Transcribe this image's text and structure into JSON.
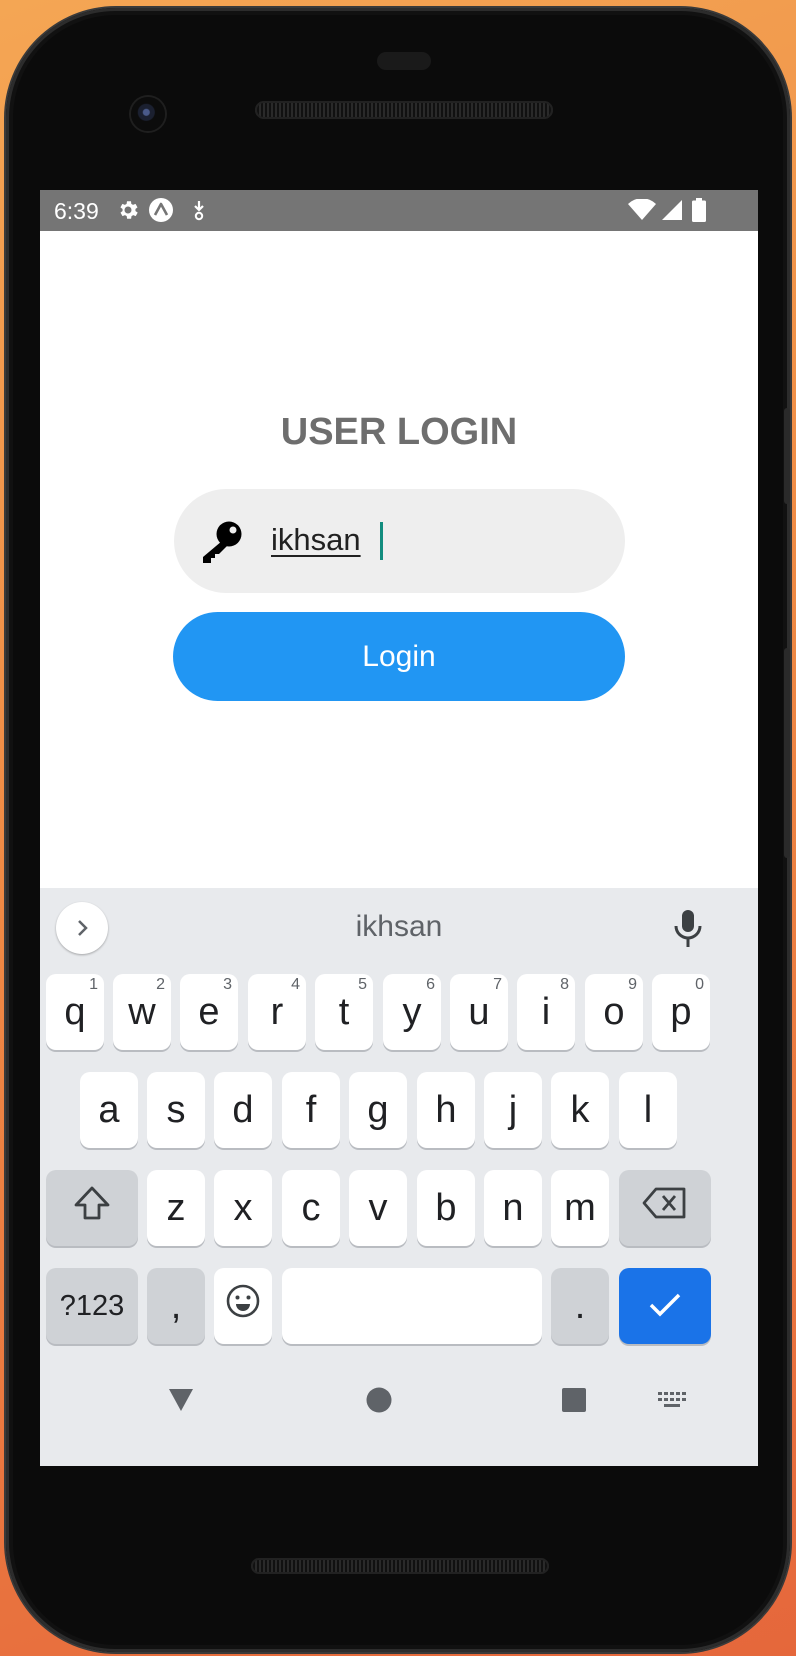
{
  "status_bar": {
    "time": "6:39",
    "left_icons": [
      "gear-icon",
      "expo-icon",
      "download-icon"
    ],
    "right_icons": [
      "wifi-icon",
      "cellular-icon",
      "battery-icon"
    ]
  },
  "app": {
    "title": "USER LOGIN",
    "username_value": "ikhsan",
    "login_label": "Login",
    "accent_color": "#2196f3"
  },
  "keyboard": {
    "suggestion": "ikhsan",
    "row1": [
      {
        "key": "q",
        "hint": "1"
      },
      {
        "key": "w",
        "hint": "2"
      },
      {
        "key": "e",
        "hint": "3"
      },
      {
        "key": "r",
        "hint": "4"
      },
      {
        "key": "t",
        "hint": "5"
      },
      {
        "key": "y",
        "hint": "6"
      },
      {
        "key": "u",
        "hint": "7"
      },
      {
        "key": "i",
        "hint": "8"
      },
      {
        "key": "o",
        "hint": "9"
      },
      {
        "key": "p",
        "hint": "0"
      }
    ],
    "row2": [
      "a",
      "s",
      "d",
      "f",
      "g",
      "h",
      "j",
      "k",
      "l"
    ],
    "row3": [
      "z",
      "x",
      "c",
      "v",
      "b",
      "n",
      "m"
    ],
    "symbols_label": "?123",
    "comma_label": ",",
    "period_label": ".",
    "action_color": "#1a73e8"
  },
  "nav_bar": {
    "icons": [
      "back-icon",
      "home-icon",
      "recents-icon",
      "keyboard-switch-icon"
    ]
  }
}
